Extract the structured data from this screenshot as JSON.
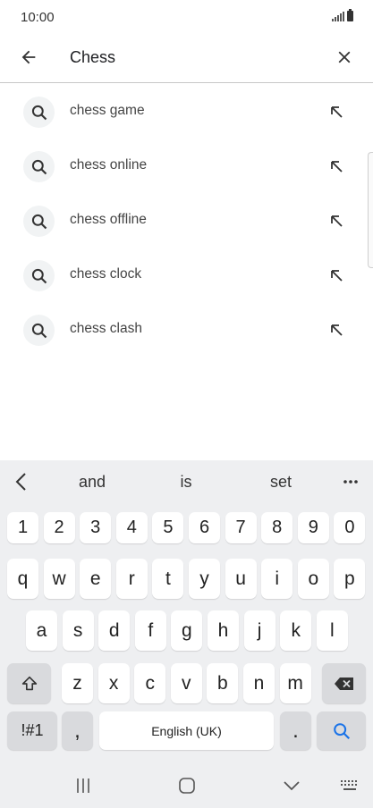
{
  "status_bar": {
    "time": "10:00"
  },
  "search": {
    "query": "Chess"
  },
  "suggestions": [
    {
      "label": "chess game"
    },
    {
      "label": "chess online"
    },
    {
      "label": "chess offline"
    },
    {
      "label": "chess clock"
    },
    {
      "label": "chess clash"
    }
  ],
  "keyboard": {
    "predictions": [
      "and",
      "is",
      "set"
    ],
    "row_numbers": [
      "1",
      "2",
      "3",
      "4",
      "5",
      "6",
      "7",
      "8",
      "9",
      "0"
    ],
    "row_top": [
      "q",
      "w",
      "e",
      "r",
      "t",
      "y",
      "u",
      "i",
      "o",
      "p"
    ],
    "row_home": [
      "a",
      "s",
      "d",
      "f",
      "g",
      "h",
      "j",
      "k",
      "l"
    ],
    "row_bottom": [
      "z",
      "x",
      "c",
      "v",
      "b",
      "n",
      "m"
    ],
    "symbols_key": "!#1",
    "comma_key": ",",
    "space_label": "English (UK)",
    "period_key": "."
  },
  "colors": {
    "accent": "#1a73e8",
    "keyboard_bg": "#eeeff1",
    "key_dark": "#d9dadd"
  },
  "icons": [
    "back-arrow-icon",
    "close-icon",
    "search-icon",
    "north-west-arrow-icon",
    "shift-icon",
    "backspace-icon",
    "recents-icon",
    "home-icon",
    "hide-keyboard-icon",
    "keyboard-icon"
  ]
}
